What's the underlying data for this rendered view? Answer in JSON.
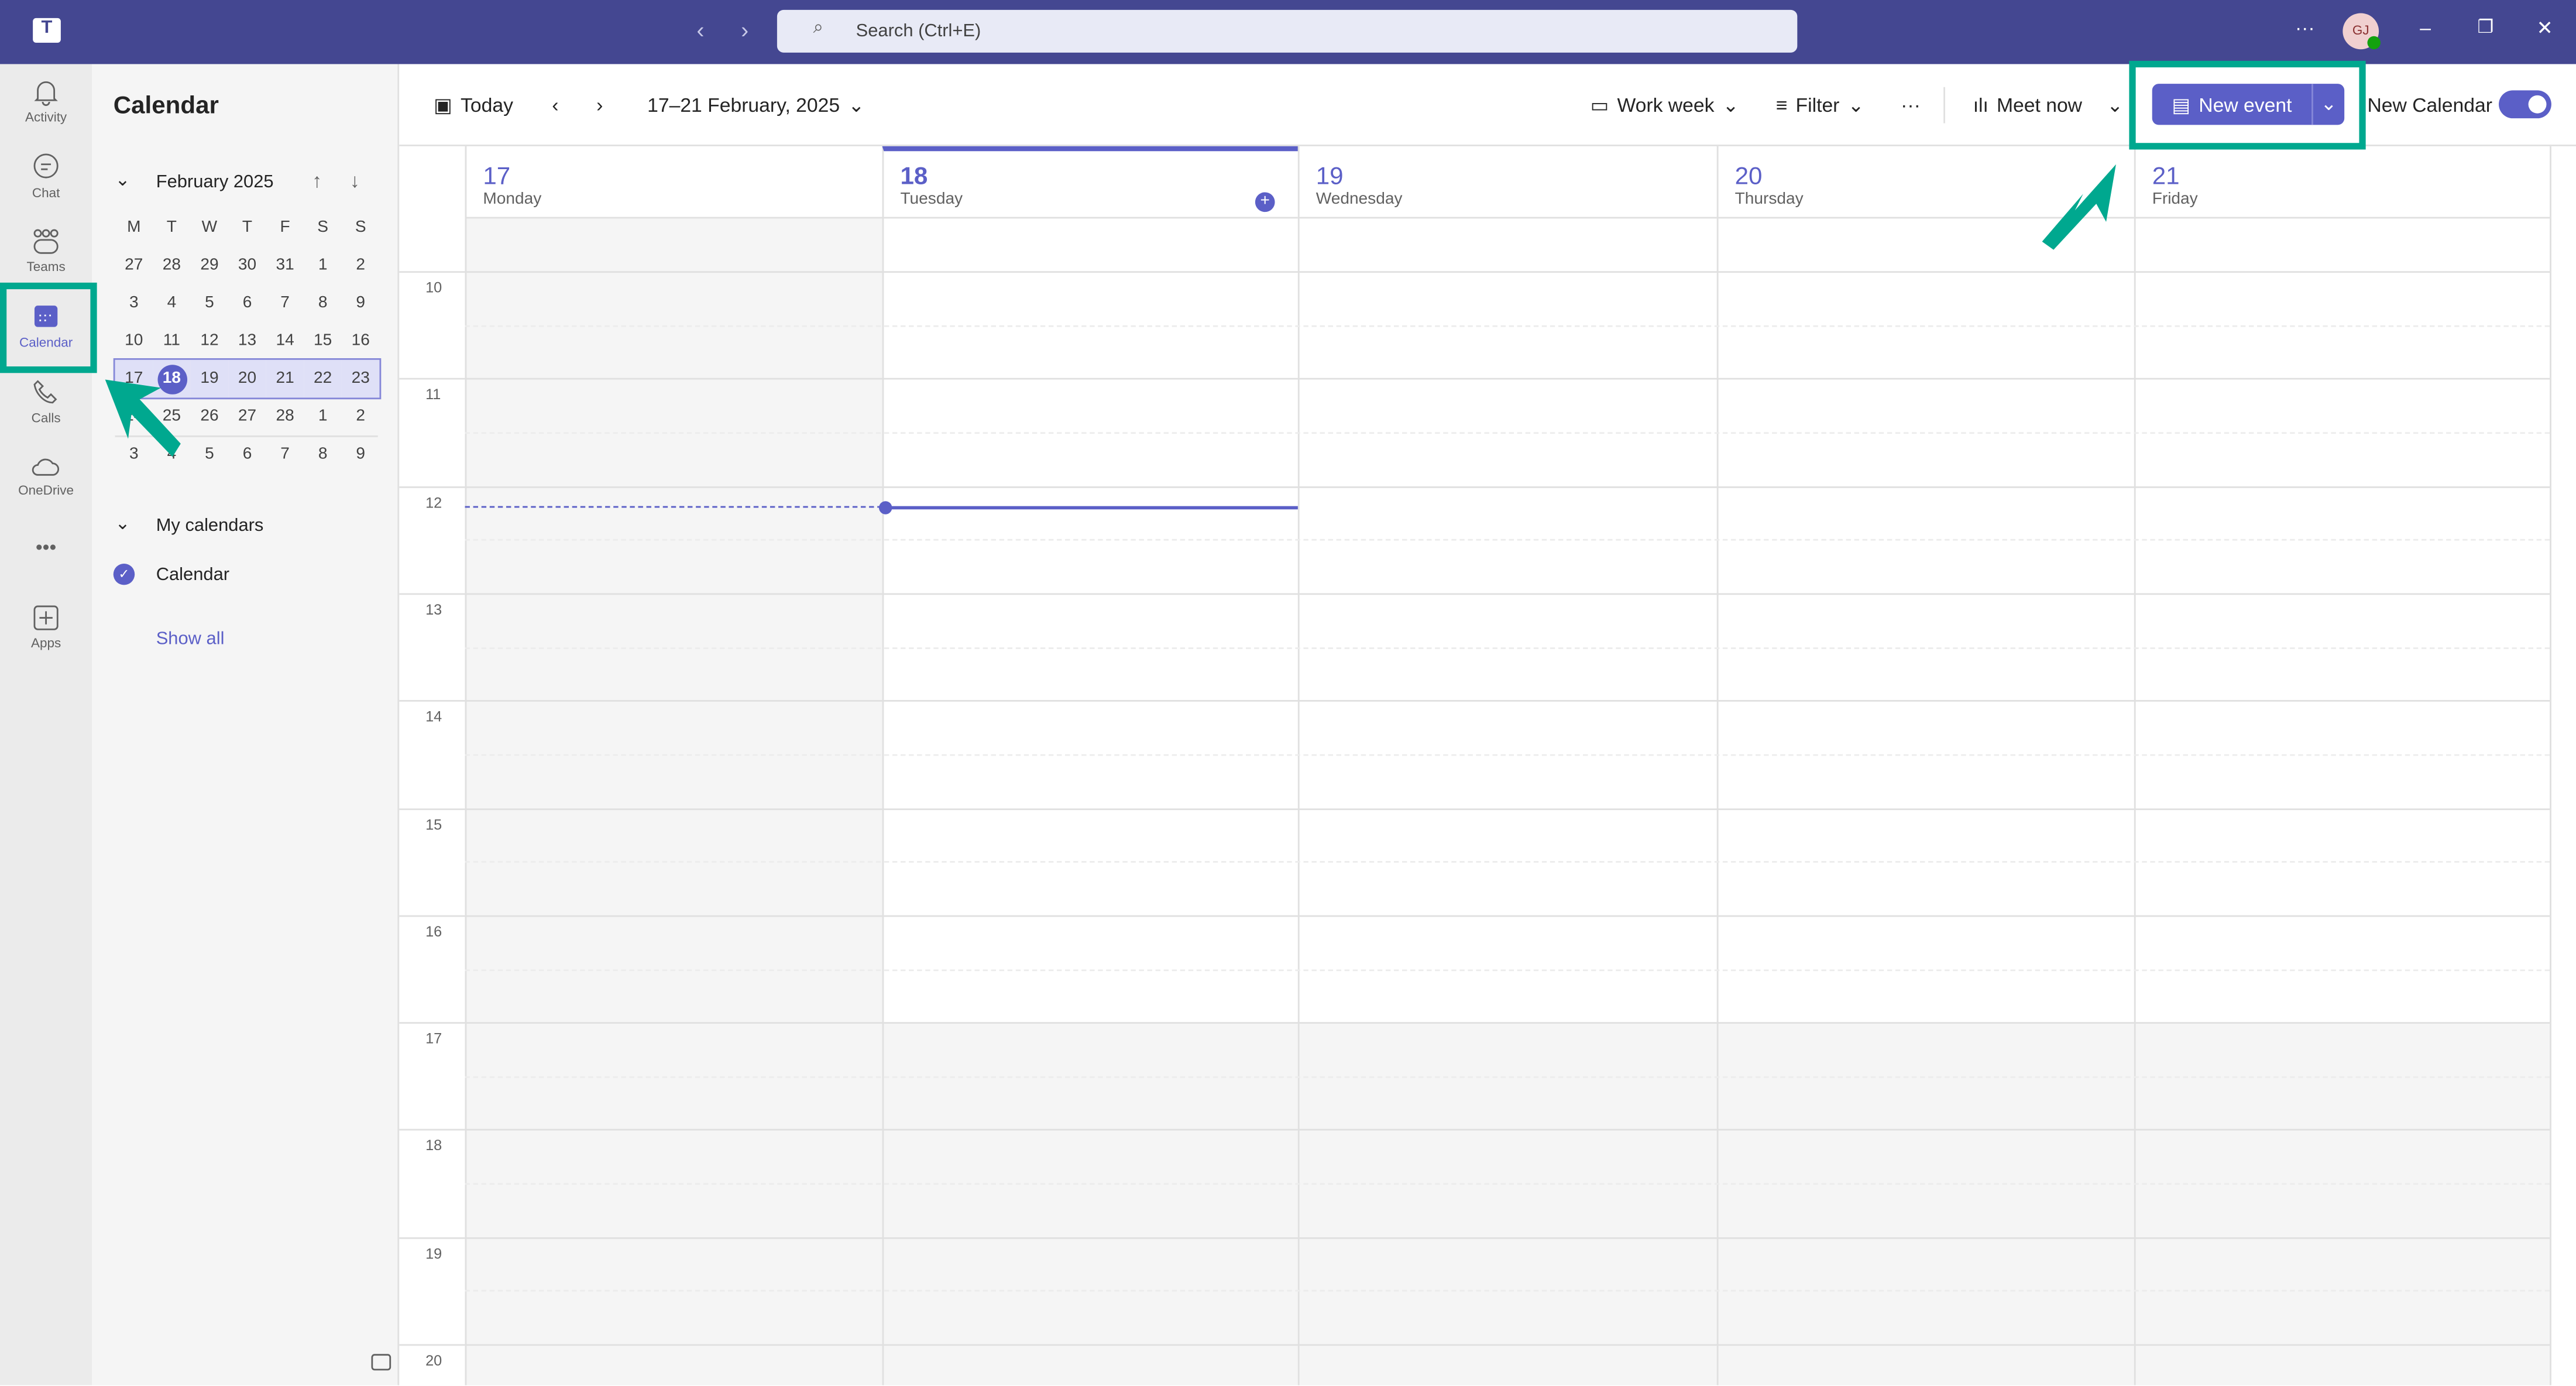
{
  "titlebar": {
    "search_placeholder": "Search (Ctrl+E)",
    "avatar_initials": "GJ",
    "accent": "#444791"
  },
  "rail": {
    "items": [
      {
        "label": "Activity",
        "icon": "bell-icon"
      },
      {
        "label": "Chat",
        "icon": "chat-icon"
      },
      {
        "label": "Teams",
        "icon": "teams-icon"
      },
      {
        "label": "Calendar",
        "icon": "calendar-icon",
        "active": true
      },
      {
        "label": "Calls",
        "icon": "phone-icon"
      },
      {
        "label": "OneDrive",
        "icon": "cloud-icon"
      },
      {
        "label": "Apps",
        "icon": "add-apps-icon"
      }
    ]
  },
  "panel": {
    "title": "Calendar",
    "month": "February 2025",
    "weekdays": [
      "M",
      "T",
      "W",
      "T",
      "F",
      "S",
      "S"
    ],
    "weeks": [
      [
        "27",
        "28",
        "29",
        "30",
        "31",
        "1",
        "2"
      ],
      [
        "3",
        "4",
        "5",
        "6",
        "7",
        "8",
        "9"
      ],
      [
        "10",
        "11",
        "12",
        "13",
        "14",
        "15",
        "16"
      ],
      [
        "17",
        "18",
        "19",
        "20",
        "21",
        "22",
        "23"
      ],
      [
        "24",
        "25",
        "26",
        "27",
        "28",
        "1",
        "2"
      ],
      [
        "3",
        "4",
        "5",
        "6",
        "7",
        "8",
        "9"
      ]
    ],
    "today": "18",
    "my_calendars": "My calendars",
    "calendar_item": "Calendar",
    "show_all": "Show all"
  },
  "toolbar": {
    "today": "Today",
    "range": "17–21 February, 2025",
    "view": "Work week",
    "filter": "Filter",
    "meet_now": "Meet now",
    "new_event": "New event",
    "new_calendar": "New Calendar",
    "new_calendar_toggle": true
  },
  "days": [
    {
      "num": "17",
      "name": "Monday"
    },
    {
      "num": "18",
      "name": "Tuesday",
      "today": true
    },
    {
      "num": "19",
      "name": "Wednesday"
    },
    {
      "num": "20",
      "name": "Thursday"
    },
    {
      "num": "21",
      "name": "Friday"
    }
  ],
  "hours": [
    "10",
    "11",
    "12",
    "13",
    "14",
    "15",
    "16",
    "17",
    "18",
    "19",
    "20"
  ],
  "colors": {
    "brand": "#5b5fc7",
    "annotation": "#00a88f"
  }
}
